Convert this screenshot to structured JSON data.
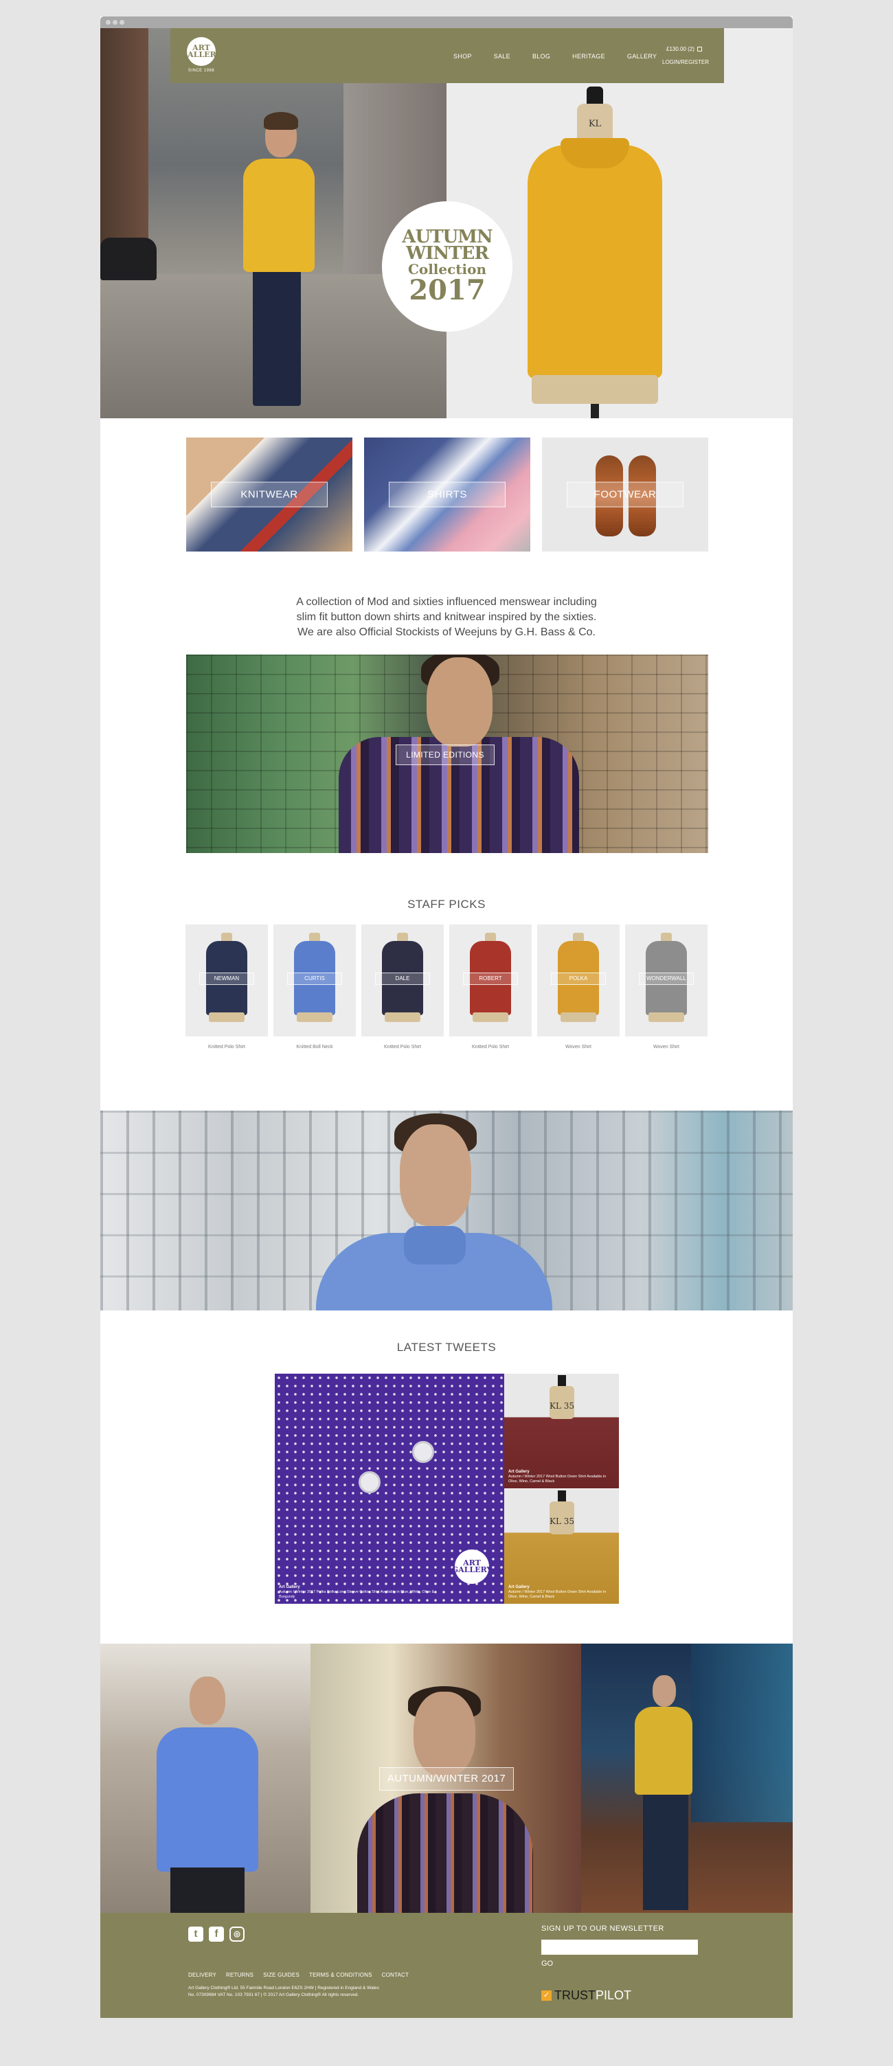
{
  "colors": {
    "brand": "#858359",
    "page_bg": "#e5e5e5"
  },
  "logo": {
    "text": "ART GALLERY",
    "since": "SINCE 1988"
  },
  "nav": {
    "items": [
      "SHOP",
      "SALE",
      "BLOG",
      "HERITAGE",
      "GALLERY"
    ],
    "cart": "£130.00  (2)",
    "login": "LOGIN/REGISTER"
  },
  "hero": {
    "badge": {
      "line1": "AUTUMN",
      "line2": "WINTER",
      "line3": "Collection",
      "line4": "2017"
    },
    "mannequin_tag": "KL"
  },
  "categories": [
    "KNITWEAR",
    "SHIRTS",
    "FOOTWEAR"
  ],
  "intro": [
    "A collection of Mod and sixties influenced menswear including",
    "slim fit button down shirts and knitwear inspired by the sixties.",
    "We are also Official Stockists of Weejuns by G.H. Bass & Co."
  ],
  "limited": {
    "button": "LIMITED EDITIONS"
  },
  "staff_picks": {
    "title": "STAFF PICKS",
    "items": [
      {
        "name": "NEWMAN",
        "caption": "Knitted Polo Shirt",
        "color": "#2b3452"
      },
      {
        "name": "CURTIS",
        "caption": "Knitted Boll Neck",
        "color": "#5a7ecc"
      },
      {
        "name": "DALE",
        "caption": "Knitted Polo Shirt",
        "color": "#2e2f45"
      },
      {
        "name": "ROBERT",
        "caption": "Knitted Polo Shirt",
        "color": "#a8342a"
      },
      {
        "name": "POLKA",
        "caption": "Woven Shirt",
        "color": "#d79b2e"
      },
      {
        "name": "WONDERWALL",
        "caption": "Woven Shirt",
        "color": "#8d8d8d"
      }
    ]
  },
  "tweets": {
    "title": "LATEST TWEETS",
    "stamp": "ART GALLERY",
    "big": {
      "handle": "Art Gallery",
      "text": "Autumn / Winter 2017 Polka Polka Long Sleeve Cotton Shirt Available in Blue, White, Olive & Burgundy"
    },
    "small": [
      {
        "handle": "Art Gallery",
        "text": "Autumn / Winter 2017 Wool Button Down Shirt Available in Olive, Wine, Camel & Black",
        "tag": "KL 35"
      },
      {
        "handle": "Art Gallery",
        "text": "Autumn / Winter 2017 Wool Button Down Shirt Available in Olive, Wine, Camel & Black",
        "tag": "KL 35"
      }
    ]
  },
  "aw": {
    "button": "AUTUMN/WINTER 2017"
  },
  "footer": {
    "social": [
      "twitter-icon",
      "facebook-icon",
      "instagram-icon"
    ],
    "links": [
      "DELIVERY",
      "RETURNS",
      "SIZE GUIDES",
      "TERMS & CONDITIONS",
      "CONTACT"
    ],
    "legal1": "Art Gallery Clothing® Ltd. 55 Fairmile Road London E6ZS 2HW | Registered in England & Wales",
    "legal2": "No. 07309984 VAT No. 103 7931 67 | © 2017 Art Gallery Clothing® All rights reserved.",
    "newsletter_title": "SIGN UP TO OUR NEWSLETTER",
    "go": "GO",
    "trust1": "TRUST",
    "trust2": "PILOT"
  }
}
